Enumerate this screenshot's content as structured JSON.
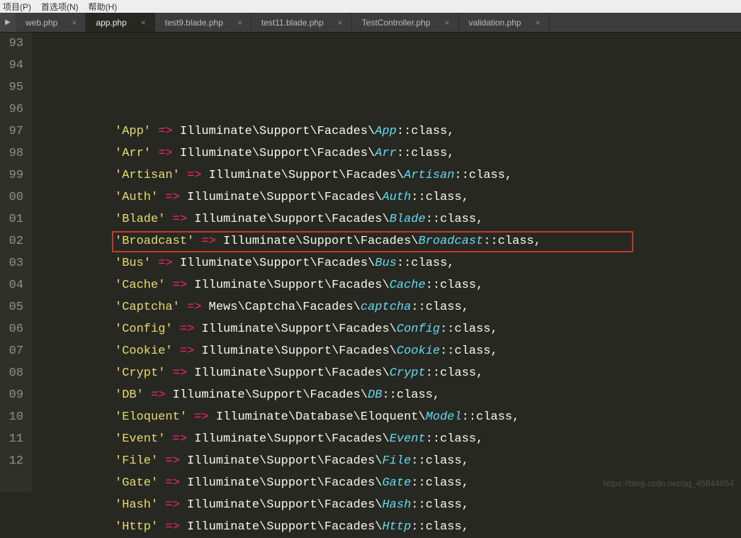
{
  "menu": {
    "project": "项目(P)",
    "prefs": "首选项(N)",
    "help": "帮助(H)"
  },
  "tabs": [
    {
      "label": "web.php",
      "active": false
    },
    {
      "label": "app.php",
      "active": true
    },
    {
      "label": "test9.blade.php",
      "active": false
    },
    {
      "label": "test11.blade.php",
      "active": false
    },
    {
      "label": "TestController.php",
      "active": false
    },
    {
      "label": "validation.php",
      "active": false
    }
  ],
  "pre_icon": "▶",
  "close_glyph": "×",
  "watermark": "https://blog.csdn.net/qq_45844654",
  "lines": [
    {
      "n": "93",
      "key": "",
      "arrow": "",
      "ns": "",
      "cls": "",
      "tail": ""
    },
    {
      "n": "94",
      "key": "'App'",
      "arrow": " => ",
      "ns": "Illuminate\\Support\\Facades\\",
      "cls": "App",
      "tail": "::class,"
    },
    {
      "n": "95",
      "key": "'Arr'",
      "arrow": " => ",
      "ns": "Illuminate\\Support\\Facades\\",
      "cls": "Arr",
      "tail": "::class,"
    },
    {
      "n": "96",
      "key": "'Artisan'",
      "arrow": " => ",
      "ns": "Illuminate\\Support\\Facades\\",
      "cls": "Artisan",
      "tail": "::class,"
    },
    {
      "n": "97",
      "key": "'Auth'",
      "arrow": " => ",
      "ns": "Illuminate\\Support\\Facades\\",
      "cls": "Auth",
      "tail": "::class,"
    },
    {
      "n": "98",
      "key": "'Blade'",
      "arrow": " => ",
      "ns": "Illuminate\\Support\\Facades\\",
      "cls": "Blade",
      "tail": "::class,"
    },
    {
      "n": "99",
      "key": "'Broadcast'",
      "arrow": " => ",
      "ns": "Illuminate\\Support\\Facades\\",
      "cls": "Broadcast",
      "tail": "::class,"
    },
    {
      "n": "00",
      "key": "'Bus'",
      "arrow": " => ",
      "ns": "Illuminate\\Support\\Facades\\",
      "cls": "Bus",
      "tail": "::class,"
    },
    {
      "n": "01",
      "key": "'Cache'",
      "arrow": " => ",
      "ns": "Illuminate\\Support\\Facades\\",
      "cls": "Cache",
      "tail": "::class,"
    },
    {
      "n": "02",
      "key": "'Captcha'",
      "arrow": " => ",
      "ns": "Mews\\Captcha\\Facades\\",
      "cls": "captcha",
      "tail": "::class,"
    },
    {
      "n": "03",
      "key": "'Config'",
      "arrow": " => ",
      "ns": "Illuminate\\Support\\Facades\\",
      "cls": "Config",
      "tail": "::class,"
    },
    {
      "n": "04",
      "key": "'Cookie'",
      "arrow": " => ",
      "ns": "Illuminate\\Support\\Facades\\",
      "cls": "Cookie",
      "tail": "::class,"
    },
    {
      "n": "05",
      "key": "'Crypt'",
      "arrow": " => ",
      "ns": "Illuminate\\Support\\Facades\\",
      "cls": "Crypt",
      "tail": "::class,"
    },
    {
      "n": "06",
      "key": "'DB'",
      "arrow": " => ",
      "ns": "Illuminate\\Support\\Facades\\",
      "cls": "DB",
      "tail": "::class,"
    },
    {
      "n": "07",
      "key": "'Eloquent'",
      "arrow": " => ",
      "ns": "Illuminate\\Database\\Eloquent\\",
      "cls": "Model",
      "tail": "::class,"
    },
    {
      "n": "08",
      "key": "'Event'",
      "arrow": " => ",
      "ns": "Illuminate\\Support\\Facades\\",
      "cls": "Event",
      "tail": "::class,"
    },
    {
      "n": "09",
      "key": "'File'",
      "arrow": " => ",
      "ns": "Illuminate\\Support\\Facades\\",
      "cls": "File",
      "tail": "::class,"
    },
    {
      "n": "10",
      "key": "'Gate'",
      "arrow": " => ",
      "ns": "Illuminate\\Support\\Facades\\",
      "cls": "Gate",
      "tail": "::class,"
    },
    {
      "n": "11",
      "key": "'Hash'",
      "arrow": " => ",
      "ns": "Illuminate\\Support\\Facades\\",
      "cls": "Hash",
      "tail": "::class,"
    },
    {
      "n": "12",
      "key": "'Http'",
      "arrow": " => ",
      "ns": "Illuminate\\Support\\Facades\\",
      "cls": "Http",
      "tail": "::class,"
    }
  ]
}
